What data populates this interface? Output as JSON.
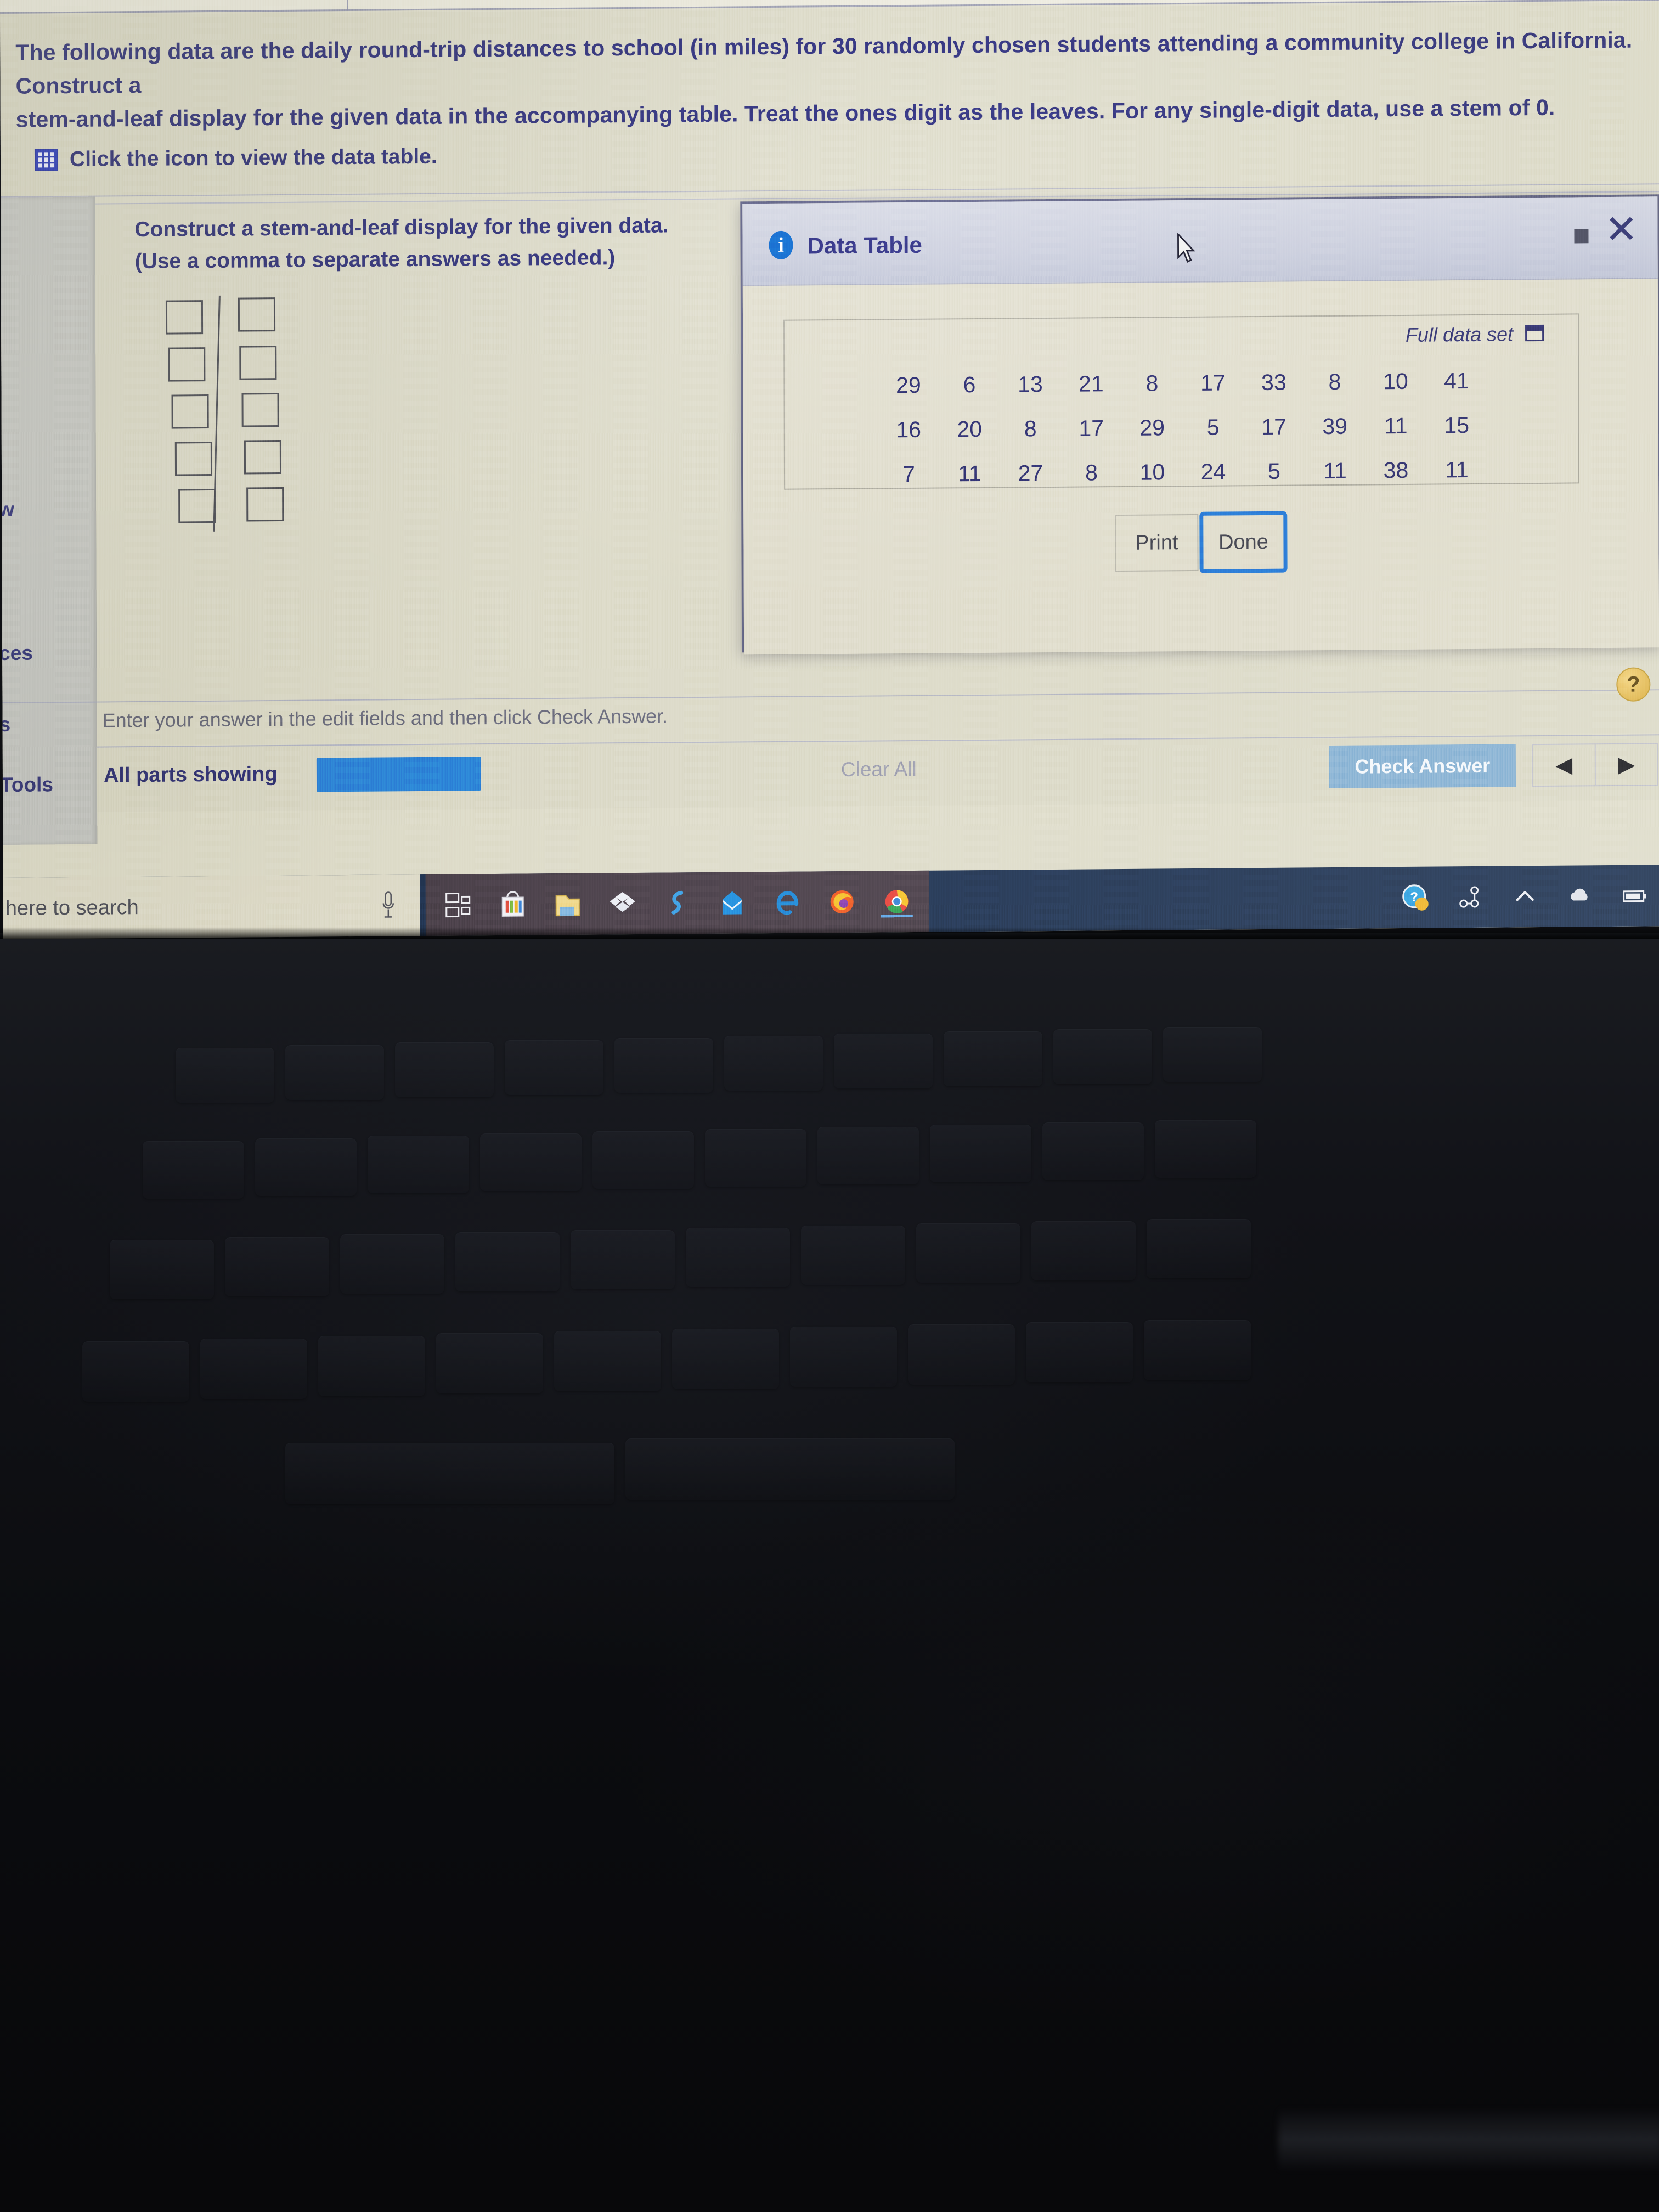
{
  "problem": {
    "statement": "The following data are the daily round-trip distances to school (in miles) for 30 randomly chosen students attending a community college in California. Construct a\nstem-and-leaf display for the given data in the accompanying table. Treat the ones digit as the leaves. For any single-digit data, use a stem of 0.",
    "data_table_link": "Click the icon to view the data table.",
    "data_table_icon": "grid-icon"
  },
  "answer_area": {
    "prompt": "Construct a stem-and-leaf display for the given data.\n(Use a comma to separate answers as needed.)",
    "rows": 5,
    "columns": 2,
    "stem_values": [
      "",
      "",
      "",
      "",
      ""
    ],
    "leaf_values": [
      "",
      "",
      "",
      "",
      ""
    ]
  },
  "sidebar": {
    "items": [
      {
        "label": "w"
      },
      {
        "label": "ces"
      },
      {
        "label": "s"
      },
      {
        "label": "Tools"
      }
    ]
  },
  "instruction": {
    "text": "Enter your answer in the edit fields and then click Check Answer."
  },
  "toolbar": {
    "all_parts_label": "All parts showing",
    "progress_color": "#2a87d8",
    "clear_all_label": "Clear All",
    "check_answer_label": "Check Answer",
    "prev_arrow": "◀",
    "next_arrow": "▶",
    "help_label": "?"
  },
  "dialog": {
    "title": "Data Table",
    "info_icon": "info-icon",
    "minimize_label": "",
    "close_label": "✕",
    "full_data_set_label": "Full data set",
    "full_data_set_icon": "popout-window-icon",
    "print_label": "Print",
    "done_label": "Done"
  },
  "chart_data": {
    "type": "table",
    "title": "Data Table",
    "subtitle": "Full data set",
    "description": "Daily round-trip distances to school (in miles) for 30 randomly chosen community college students in California.",
    "units": "miles",
    "n": 30,
    "rows": [
      [
        29,
        6,
        13,
        21,
        8,
        17,
        33,
        8,
        10,
        41
      ],
      [
        16,
        20,
        8,
        17,
        29,
        5,
        17,
        39,
        11,
        15
      ],
      [
        7,
        11,
        27,
        8,
        10,
        24,
        5,
        11,
        38,
        11
      ]
    ],
    "values": [
      29,
      6,
      13,
      21,
      8,
      17,
      33,
      8,
      10,
      41,
      16,
      20,
      8,
      17,
      29,
      5,
      17,
      39,
      11,
      15,
      7,
      11,
      27,
      8,
      10,
      24,
      5,
      11,
      38,
      11
    ]
  },
  "taskbar": {
    "search_placeholder": "here to search",
    "mic_icon": "microphone-icon",
    "apps": [
      {
        "name": "task-view-icon",
        "label": ""
      },
      {
        "name": "microsoft-store-icon",
        "label": ""
      },
      {
        "name": "file-explorer-icon",
        "label": ""
      },
      {
        "name": "dropbox-icon",
        "label": ""
      },
      {
        "name": "skype-icon",
        "label": ""
      },
      {
        "name": "mail-icon",
        "label": ""
      },
      {
        "name": "microsoft-edge-icon",
        "label": ""
      },
      {
        "name": "firefox-icon",
        "label": ""
      },
      {
        "name": "google-chrome-icon",
        "label": ""
      }
    ],
    "tray": [
      {
        "name": "get-help-icon"
      },
      {
        "name": "network-icon"
      },
      {
        "name": "show-hidden-icons-icon"
      },
      {
        "name": "onedrive-icon"
      },
      {
        "name": "battery-icon"
      }
    ]
  }
}
